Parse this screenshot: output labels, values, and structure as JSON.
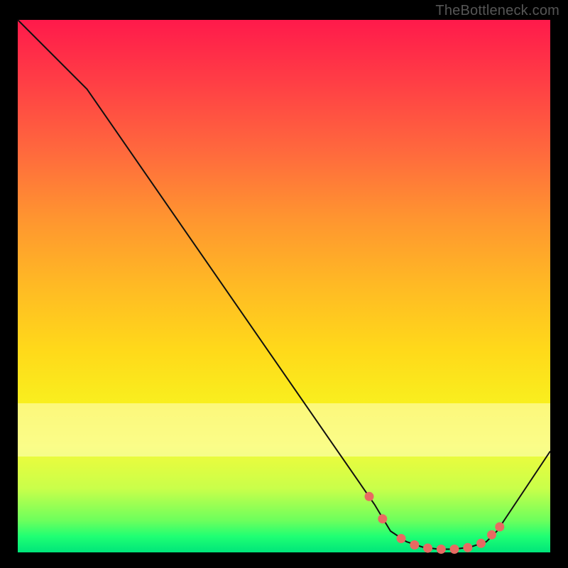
{
  "attribution": "TheBottleneck.com",
  "colors": {
    "frame_bg": "#000000",
    "curve_stroke": "#101010",
    "marker_fill": "#e86a62",
    "marker_stroke": "#d2433a"
  },
  "chart_data": {
    "type": "line",
    "title": "",
    "xlabel": "",
    "ylabel": "",
    "xlim": [
      0,
      100
    ],
    "ylim": [
      0,
      100
    ],
    "pale_band": {
      "y_start": 72,
      "y_end": 82
    },
    "series": [
      {
        "name": "bottleneck-curve",
        "x": [
          0,
          13,
          67,
          70,
          73,
          76,
          79,
          82,
          85,
          88,
          90,
          100
        ],
        "y": [
          100,
          87,
          9,
          4,
          2,
          1,
          0.6,
          0.6,
          1,
          2,
          4,
          19
        ]
      }
    ],
    "markers": {
      "name": "highlight-dots",
      "x": [
        66,
        68.5,
        72,
        74.5,
        77,
        79.5,
        82,
        84.5,
        87,
        89,
        90.5
      ],
      "y": [
        10.5,
        6.3,
        2.6,
        1.4,
        0.8,
        0.6,
        0.6,
        0.9,
        1.7,
        3.3,
        4.8
      ]
    }
  }
}
